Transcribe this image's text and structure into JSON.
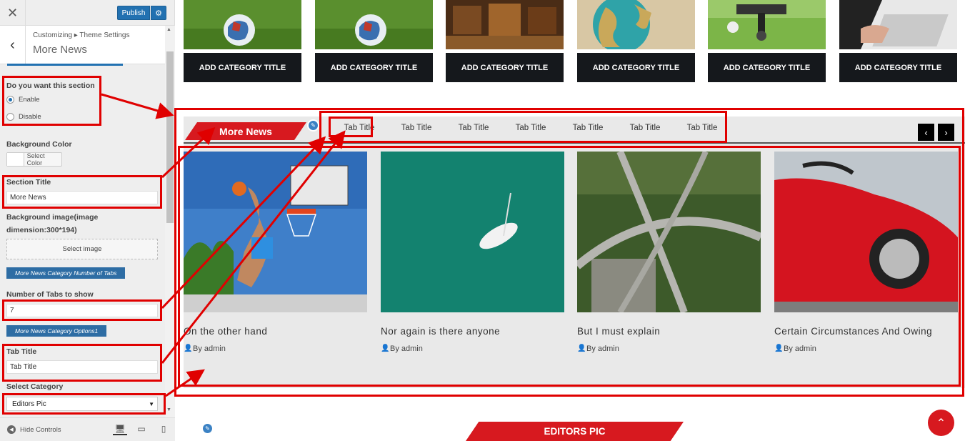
{
  "customizer": {
    "close_icon": "✕",
    "publish_label": "Publish",
    "gear_icon": "⚙",
    "back_icon": "‹",
    "breadcrumb": "Customizing ▸ Theme Settings",
    "section_title": "More News",
    "fields": {
      "section_toggle_label": "Do you want this section",
      "enable_label": "Enable",
      "disable_label": "Disable",
      "enabled": true,
      "background_color_label": "Background Color",
      "select_color_label": "Select Color",
      "section_title_label": "Section Title",
      "section_title_value": "More News",
      "background_image_label_1": "Background image(image",
      "background_image_label_2": "dimension:300*194)",
      "select_image_label": "Select image",
      "tabs_group_label": "More News Category Number of Tabs",
      "num_tabs_label": "Number of Tabs to show",
      "num_tabs_value": "7",
      "options_group_label": "More News Category Options1",
      "tab_title_label": "Tab Title",
      "tab_title_value": "Tab Title",
      "select_category_label": "Select Category",
      "select_category_value": "Editors Pic"
    },
    "bottom": {
      "hide_controls_label": "Hide Controls",
      "desktop_icon": "🖥",
      "tablet_icon": "▭",
      "mobile_icon": "▯"
    }
  },
  "preview": {
    "category_cards": [
      {
        "title": "ADD CATEGORY TITLE",
        "image": "soccer-ball-grass"
      },
      {
        "title": "ADD CATEGORY TITLE",
        "image": "soccer-ball-grass"
      },
      {
        "title": "ADD CATEGORY TITLE",
        "image": "library-room"
      },
      {
        "title": "ADD CATEGORY TITLE",
        "image": "globe"
      },
      {
        "title": "ADD CATEGORY TITLE",
        "image": "drone-camera"
      },
      {
        "title": "ADD CATEGORY TITLE",
        "image": "laptop-hands"
      }
    ],
    "more_news": {
      "title": "More News",
      "tabs": [
        "Tab Title",
        "Tab Title",
        "Tab Title",
        "Tab Title",
        "Tab Title",
        "Tab Title",
        "Tab Title"
      ],
      "prev_icon": "‹",
      "next_icon": "›",
      "posts": [
        {
          "title": "On the other hand",
          "author": "By admin",
          "image": "basketball-dunk"
        },
        {
          "title": "Nor again is there anyone",
          "author": "By admin",
          "image": "boat-on-sea"
        },
        {
          "title": "But I must explain",
          "author": "By admin",
          "image": "highway-aerial"
        },
        {
          "title": "Certain Circumstances And Owing",
          "author": "By admin",
          "image": "red-sports-car"
        }
      ]
    },
    "editors_pic_title": "EDITORS PIC",
    "scroll_top_icon": "⌃"
  },
  "colors": {
    "accent": "#d7191f",
    "publish": "#2271b1",
    "annotation": "#e00000"
  }
}
